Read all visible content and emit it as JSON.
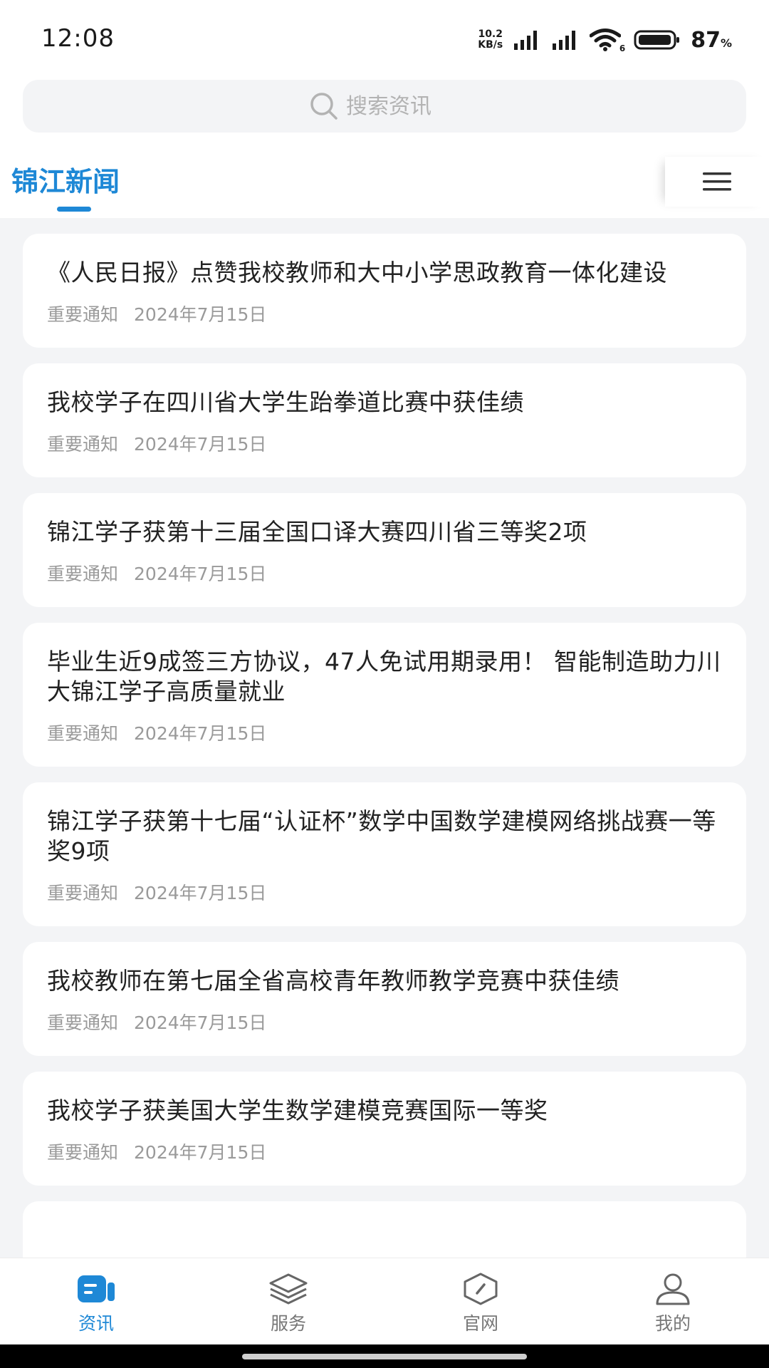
{
  "status_bar": {
    "time": "12:08",
    "net_speed_value": "10.2",
    "net_speed_unit": "KB/s",
    "wifi_sub": "6",
    "battery": "87",
    "battery_unit": "%"
  },
  "search": {
    "placeholder": "搜索资讯"
  },
  "tabs": {
    "active_label": "锦江新闻"
  },
  "news": [
    {
      "title": "《人民日报》点赞我校教师和大中小学思政教育一体化建设",
      "category": "重要通知",
      "date": "2024年7月15日"
    },
    {
      "title": "我校学子在四川省大学生跆拳道比赛中获佳绩",
      "category": "重要通知",
      "date": "2024年7月15日"
    },
    {
      "title": "锦江学子获第十三届全国口译大赛四川省三等奖2项",
      "category": "重要通知",
      "date": "2024年7月15日"
    },
    {
      "title": "毕业生近9成签三方协议，47人免试用期录用！ 智能制造助力川大锦江学子高质量就业",
      "category": "重要通知",
      "date": "2024年7月15日"
    },
    {
      "title": "锦江学子获第十七届“认证杯”数学中国数学建模网络挑战赛一等奖9项",
      "category": "重要通知",
      "date": "2024年7月15日"
    },
    {
      "title": "我校教师在第七届全省高校青年教师教学竞赛中获佳绩",
      "category": "重要通知",
      "date": "2024年7月15日"
    },
    {
      "title": "我校学子获美国大学生数学建模竞赛国际一等奖",
      "category": "重要通知",
      "date": "2024年7月15日"
    },
    {
      "title": "",
      "category": "",
      "date": ""
    }
  ],
  "bottom_nav": [
    {
      "label": "资讯",
      "icon": "news-icon",
      "active": true
    },
    {
      "label": "服务",
      "icon": "layers-icon",
      "active": false
    },
    {
      "label": "官网",
      "icon": "compass-icon",
      "active": false
    },
    {
      "label": "我的",
      "icon": "user-icon",
      "active": false
    }
  ],
  "colors": {
    "accent": "#1e88d6",
    "background": "#f3f4f6",
    "card": "#ffffff",
    "meta_text": "#9a9a9a"
  }
}
